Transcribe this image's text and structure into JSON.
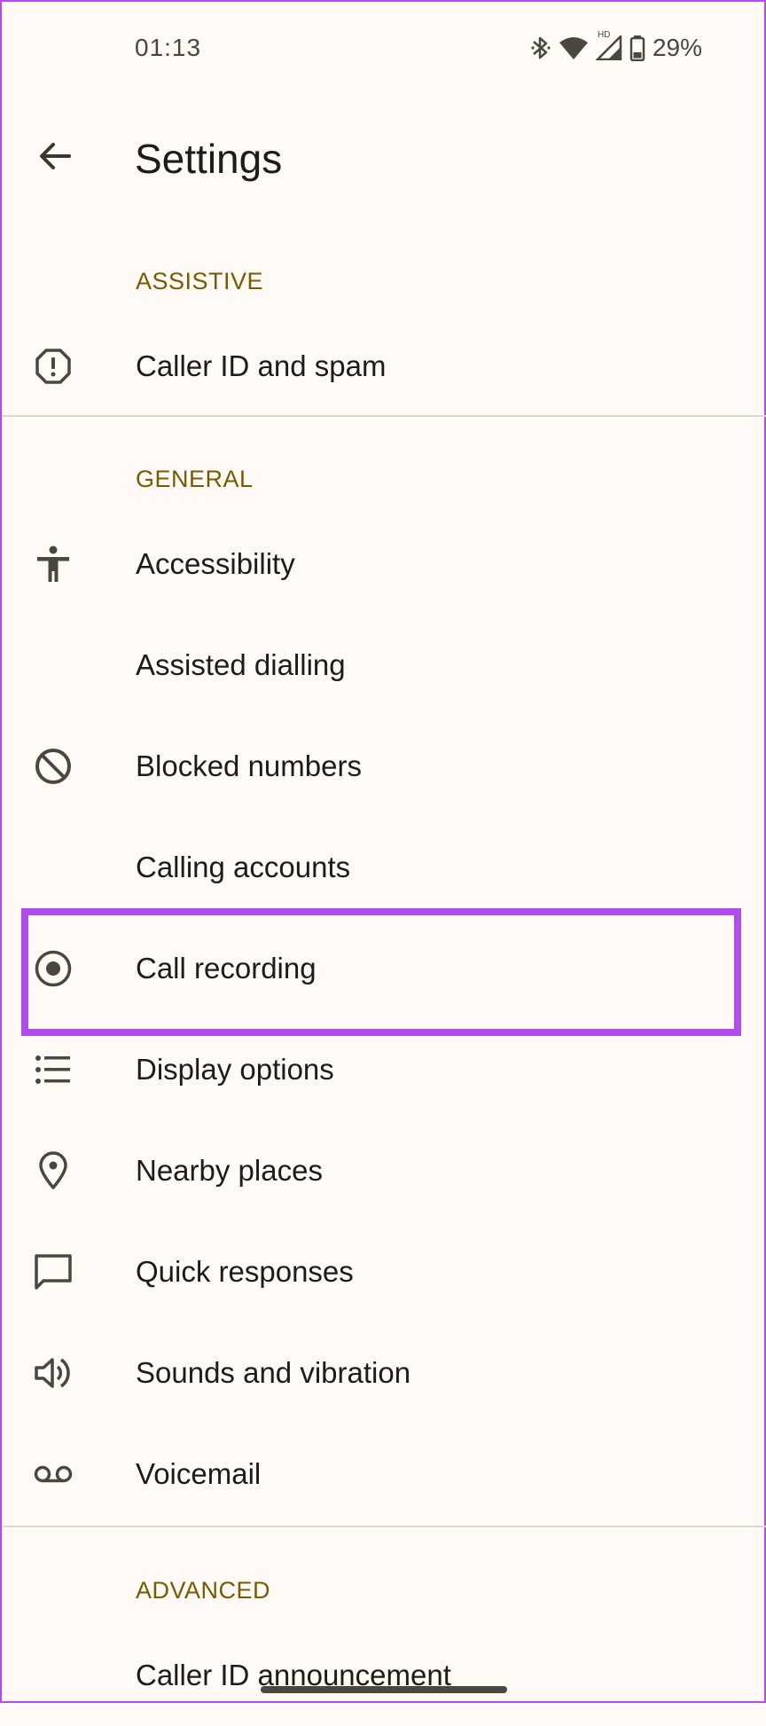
{
  "status_bar": {
    "time": "01:13",
    "battery": "29%",
    "network_badge": "HD",
    "icons": [
      "bluetooth-icon",
      "wifi-icon",
      "signal-icon",
      "battery-icon"
    ]
  },
  "header": {
    "title": "Settings",
    "back_icon": "arrow-left-icon"
  },
  "sections": {
    "assistive": {
      "title": "ASSISTIVE",
      "items": [
        {
          "label": "Caller ID and spam",
          "icon": "spam-warning-icon"
        }
      ]
    },
    "general": {
      "title": "GENERAL",
      "items": [
        {
          "label": "Accessibility",
          "icon": "accessibility-icon"
        },
        {
          "label": "Assisted dialling",
          "icon": ""
        },
        {
          "label": "Blocked numbers",
          "icon": "block-icon"
        },
        {
          "label": "Calling accounts",
          "icon": ""
        },
        {
          "label": "Call recording",
          "icon": "record-icon",
          "highlighted": true
        },
        {
          "label": "Display options",
          "icon": "list-icon"
        },
        {
          "label": "Nearby places",
          "icon": "location-pin-icon"
        },
        {
          "label": "Quick responses",
          "icon": "chat-bubble-icon"
        },
        {
          "label": "Sounds and vibration",
          "icon": "speaker-icon"
        },
        {
          "label": "Voicemail",
          "icon": "voicemail-icon"
        }
      ]
    },
    "advanced": {
      "title": "ADVANCED",
      "items": [
        {
          "label": "Caller ID announcement",
          "icon": ""
        }
      ]
    }
  },
  "colors": {
    "background": "#fffaf6",
    "section_header": "#7a5a00",
    "icon": "#4b463f",
    "highlight": "#b14dea"
  }
}
